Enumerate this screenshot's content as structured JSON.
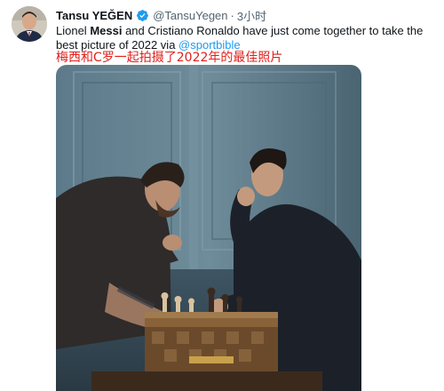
{
  "tweet": {
    "author": {
      "display_name": "Tansu YEĞEN",
      "handle": "@TansuYegen",
      "avatar_icon": "profile-avatar",
      "verified_icon": "verified-badge-icon",
      "verified_color": "#1d9bf0"
    },
    "separator": "·",
    "time": "3小时",
    "text": {
      "part1": "Lionel ",
      "bold1": "Messi",
      "part2": " and Cristiano Ronaldo have just come together to take the best picture of 2022 via ",
      "mention": "@sportbible"
    },
    "overlay_caption": "梅西和C罗一起拍摄了2022年的最佳照片",
    "overlay_caption_color": "#e0201b",
    "image_description_icon": "chess-photo"
  }
}
